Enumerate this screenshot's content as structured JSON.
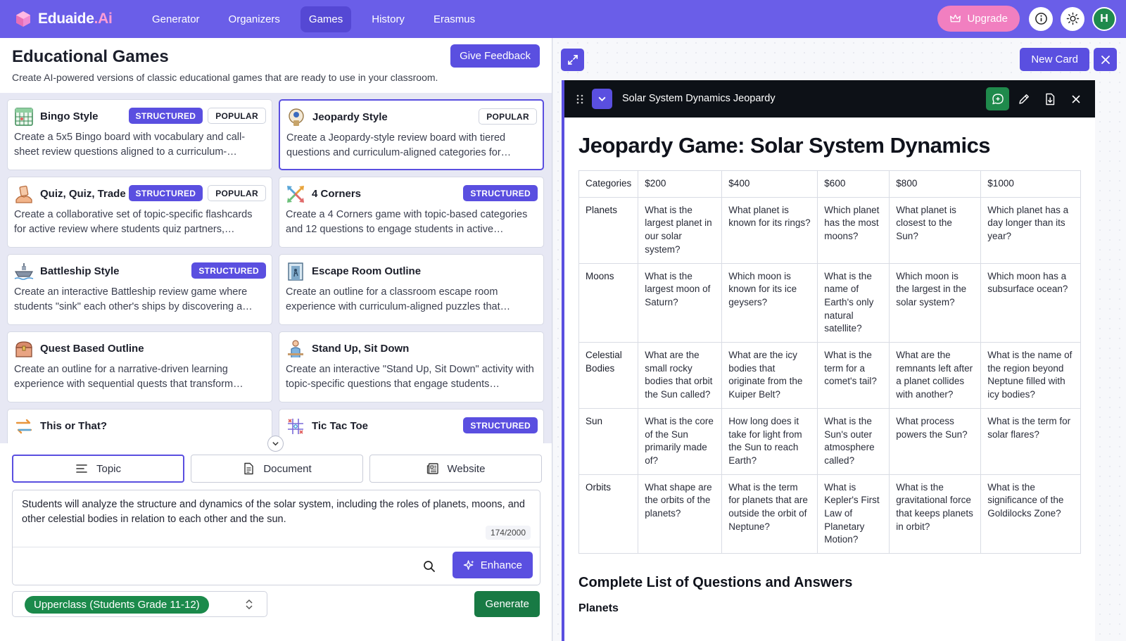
{
  "brand": {
    "name": "Eduaide",
    "suffix": ".Ai"
  },
  "nav": {
    "items": [
      {
        "label": "Generator",
        "active": false
      },
      {
        "label": "Organizers",
        "active": false
      },
      {
        "label": "Games",
        "active": true
      },
      {
        "label": "History",
        "active": false
      },
      {
        "label": "Erasmus",
        "active": false
      }
    ],
    "upgrade_label": "Upgrade",
    "avatar_initial": "H"
  },
  "left": {
    "title": "Educational Games",
    "subtitle": "Create AI-powered versions of classic educational games that are ready to use in your classroom.",
    "feedback_label": "Give Feedback"
  },
  "games": [
    {
      "title": "Bingo Style",
      "icon": "bingo-card-icon",
      "badges": [
        "STRUCTURED",
        "POPULAR"
      ],
      "description": "Create a 5x5 Bingo board with vocabulary and call-sheet review questions aligned to a curriculum-…",
      "selected": false
    },
    {
      "title": "Jeopardy Style",
      "icon": "jeopardy-podium-icon",
      "badges": [
        "POPULAR"
      ],
      "description": "Create a Jeopardy-style review board with tiered questions and curriculum-aligned categories for…",
      "selected": true
    },
    {
      "title": "Quiz, Quiz, Trade",
      "icon": "trade-hands-icon",
      "badges": [
        "STRUCTURED",
        "POPULAR"
      ],
      "description": "Create a collaborative set of topic-specific flashcards for active review where students quiz partners,…",
      "selected": false
    },
    {
      "title": "4 Corners",
      "icon": "four-arrows-icon",
      "badges": [
        "STRUCTURED"
      ],
      "description": "Create a 4 Corners game with topic-based categories and 12 questions to engage students in active…",
      "selected": false
    },
    {
      "title": "Battleship Style",
      "icon": "battleship-icon",
      "badges": [
        "STRUCTURED"
      ],
      "description": "Create an interactive Battleship review game where students \"sink\" each other's ships by discovering a…",
      "selected": false
    },
    {
      "title": "Escape Room Outline",
      "icon": "escape-door-icon",
      "badges": [],
      "description": "Create an outline for a classroom escape room experience with curriculum-aligned puzzles that…",
      "selected": false
    },
    {
      "title": "Quest Based Outline",
      "icon": "treasure-chest-icon",
      "badges": [],
      "description": "Create an outline for a narrative-driven learning experience with sequential quests that transform…",
      "selected": false
    },
    {
      "title": "Stand Up, Sit Down",
      "icon": "stand-up-icon",
      "badges": [],
      "description": "Create an interactive \"Stand Up, Sit Down\" activity with topic-specific questions that engage students…",
      "selected": false
    },
    {
      "title": "This or That?",
      "icon": "swap-arrows-icon",
      "badges": [],
      "description": "",
      "selected": false
    },
    {
      "title": "Tic Tac Toe",
      "icon": "tic-tac-toe-icon",
      "badges": [
        "STRUCTURED"
      ],
      "description": "",
      "selected": false
    }
  ],
  "source_tabs": [
    {
      "label": "Topic",
      "icon": "lines-icon",
      "active": true
    },
    {
      "label": "Document",
      "icon": "document-icon",
      "active": false
    },
    {
      "label": "Website",
      "icon": "newspaper-icon",
      "active": false
    }
  ],
  "topic": {
    "text": "Students will analyze the structure and dynamics of the solar system, including the roles of planets, moons, and other celestial bodies in relation to each other and the sun.",
    "char_count": "174/2000",
    "enhance_label": "Enhance"
  },
  "grade": {
    "selected": "Upperclass (Students Grade 11-12)"
  },
  "generate_label": "Generate",
  "right": {
    "new_card_label": "New Card",
    "card_title": "Solar System Dynamics Jeopardy",
    "doc_heading": "Jeopardy Game: Solar System Dynamics",
    "section_heading": "Complete List of Questions and Answers",
    "subsection_heading": "Planets"
  },
  "table": {
    "headers": [
      "Categories",
      "$200",
      "$400",
      "$600",
      "$800",
      "$1000"
    ],
    "rows": [
      [
        "Planets",
        "What is the largest planet in our solar system?",
        "What planet is known for its rings?",
        "Which planet has the most moons?",
        "What planet is closest to the Sun?",
        "Which planet has a day longer than its year?"
      ],
      [
        "Moons",
        "What is the largest moon of Saturn?",
        "Which moon is known for its ice geysers?",
        "What is the name of Earth's only natural satellite?",
        "Which moon is the largest in the solar system?",
        "Which moon has a subsurface ocean?"
      ],
      [
        "Celestial Bodies",
        "What are the small rocky bodies that orbit the Sun called?",
        "What are the icy bodies that originate from the Kuiper Belt?",
        "What is the term for a comet's tail?",
        "What are the remnants left after a planet collides with another?",
        "What is the name of the region beyond Neptune filled with icy bodies?"
      ],
      [
        "Sun",
        "What is the core of the Sun primarily made of?",
        "How long does it take for light from the Sun to reach Earth?",
        "What is the Sun's outer atmosphere called?",
        "What process powers the Sun?",
        "What is the term for solar flares?"
      ],
      [
        "Orbits",
        "What shape are the orbits of the planets?",
        "What is the term for planets that are outside the orbit of Neptune?",
        "What is Kepler's First Law of Planetary Motion?",
        "What is the gravitational force that keeps planets in orbit?",
        "What is the significance of the Goldilocks Zone?"
      ]
    ]
  }
}
